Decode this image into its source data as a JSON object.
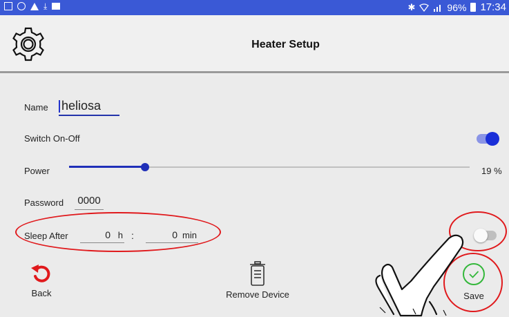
{
  "status_bar": {
    "battery": "96%",
    "time": "17:34"
  },
  "app_bar": {
    "title": "Heater Setup"
  },
  "form": {
    "name_label": "Name",
    "name_value": "heliosa",
    "switch_label": "Switch On-Off",
    "switch_on": true,
    "power_label": "Power",
    "power_value_text": "19 %",
    "power_value": 0.19,
    "password_label": "Password",
    "password_value": "0000",
    "sleep_label": "Sleep After",
    "sleep_hours": "0",
    "sleep_hours_unit": "h",
    "sleep_separator": ":",
    "sleep_minutes": "0",
    "sleep_minutes_unit": "min",
    "sleep_switch_on": false
  },
  "actions": {
    "back_label": "Back",
    "remove_label": "Remove Device",
    "save_label": "Save"
  },
  "colors": {
    "status_bar": "#3a59d6",
    "accent": "#1f2fb8",
    "annotation": "#e0191c",
    "back_icon": "#e0191c",
    "save_check": "#33b73a"
  }
}
